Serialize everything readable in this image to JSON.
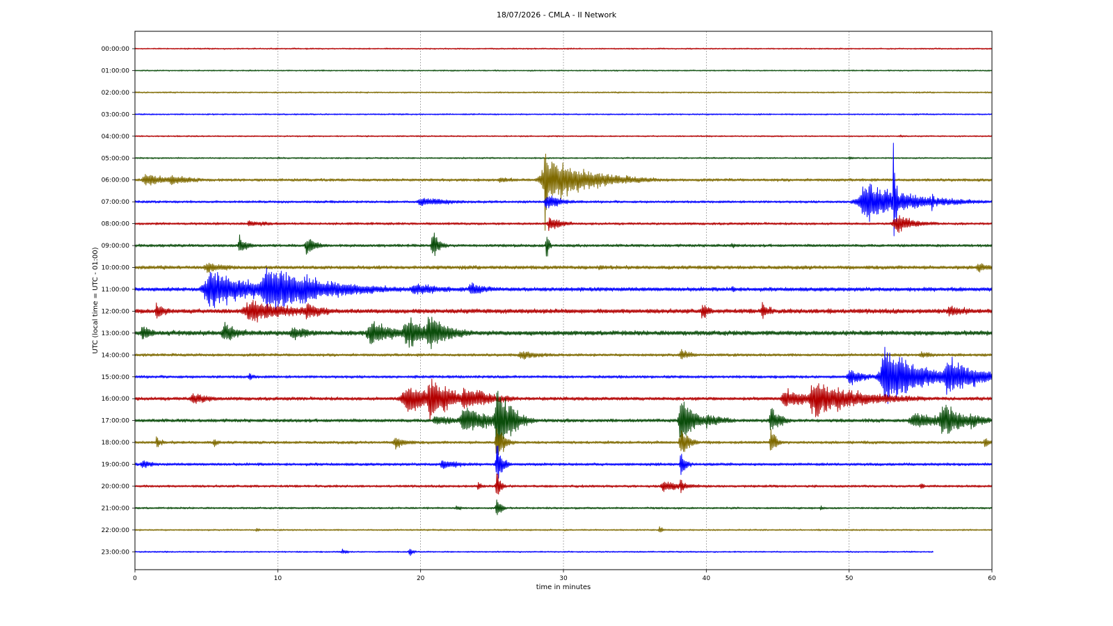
{
  "chart_data": {
    "type": "line",
    "title": "18/07/2026 - CMLA - II Network",
    "xlabel": "time in minutes",
    "ylabel": "UTC (local time = UTC - 01:00)",
    "xlim": [
      0,
      60
    ],
    "xticks": [
      0,
      10,
      20,
      30,
      40,
      50,
      60
    ],
    "grid": "vertical dashed",
    "colors": [
      "#b30000",
      "#0b4d0b",
      "#7f6a00",
      "#0000ff"
    ],
    "rows": [
      {
        "label": "00:00:00",
        "noise": 1.2,
        "events": []
      },
      {
        "label": "01:00:00",
        "noise": 1.2,
        "events": []
      },
      {
        "label": "02:00:00",
        "noise": 1.3,
        "events": []
      },
      {
        "label": "03:00:00",
        "noise": 1.3,
        "events": [
          {
            "t": 37.5,
            "amp": 2,
            "dur": 0.3
          }
        ]
      },
      {
        "label": "04:00:00",
        "noise": 1.3,
        "events": [
          {
            "t": 53.5,
            "amp": 3,
            "dur": 0.6
          }
        ]
      },
      {
        "label": "05:00:00",
        "noise": 1.4,
        "events": [
          {
            "t": 10,
            "amp": 3,
            "dur": 0.3
          },
          {
            "t": 50,
            "amp": 4,
            "dur": 0.6
          }
        ]
      },
      {
        "label": "06:00:00",
        "noise": 2.5,
        "events": [
          {
            "t": 0.7,
            "amp": 14,
            "dur": 1.5
          },
          {
            "t": 2.5,
            "amp": 10,
            "dur": 2.0
          },
          {
            "t": 25.5,
            "amp": 6,
            "dur": 1.5
          },
          {
            "t": 28.7,
            "amp": 120,
            "dur": 0.25
          },
          {
            "t": 28.8,
            "amp": 45,
            "dur": 3.0
          },
          {
            "t": 32.5,
            "amp": 10,
            "dur": 1.0
          },
          {
            "t": 35,
            "amp": 6,
            "dur": 1.0
          }
        ]
      },
      {
        "label": "07:00:00",
        "noise": 2.2,
        "events": [
          {
            "t": 20,
            "amp": 9,
            "dur": 2.5
          },
          {
            "t": 28.8,
            "amp": 14,
            "dur": 1.2
          },
          {
            "t": 51,
            "amp": 35,
            "dur": 3.5
          },
          {
            "t": 53.1,
            "amp": 110,
            "dur": 0.2
          },
          {
            "t": 55.8,
            "amp": 20,
            "dur": 0.2
          }
        ]
      },
      {
        "label": "08:00:00",
        "noise": 2.2,
        "events": [
          {
            "t": 8,
            "amp": 6,
            "dur": 2.0
          },
          {
            "t": 29,
            "amp": 14,
            "dur": 1.0
          },
          {
            "t": 53.2,
            "amp": 18,
            "dur": 1.5
          }
        ]
      },
      {
        "label": "09:00:00",
        "noise": 2.5,
        "events": [
          {
            "t": 7.3,
            "amp": 18,
            "dur": 0.6
          },
          {
            "t": 12,
            "amp": 18,
            "dur": 0.8
          },
          {
            "t": 20.8,
            "amp": 28,
            "dur": 0.5
          },
          {
            "t": 28.8,
            "amp": 40,
            "dur": 0.15
          },
          {
            "t": 41.8,
            "amp": 6,
            "dur": 0.5
          }
        ]
      },
      {
        "label": "10:00:00",
        "noise": 3.2,
        "events": [
          {
            "t": 5,
            "amp": 10,
            "dur": 2.0
          },
          {
            "t": 32.5,
            "amp": 6,
            "dur": 1.0
          },
          {
            "t": 59,
            "amp": 10,
            "dur": 1.2
          }
        ]
      },
      {
        "label": "11:00:00",
        "noise": 3.5,
        "events": [
          {
            "t": 5.2,
            "amp": 40,
            "dur": 3.0
          },
          {
            "t": 9.2,
            "amp": 48,
            "dur": 4.0
          },
          {
            "t": 12,
            "amp": 14,
            "dur": 2.0
          },
          {
            "t": 19.5,
            "amp": 12,
            "dur": 2.5
          },
          {
            "t": 23.5,
            "amp": 12,
            "dur": 1.5
          },
          {
            "t": 41.8,
            "amp": 8,
            "dur": 0.5
          }
        ]
      },
      {
        "label": "12:00:00",
        "noise": 4,
        "events": [
          {
            "t": 1.5,
            "amp": 16,
            "dur": 0.8
          },
          {
            "t": 8,
            "amp": 20,
            "dur": 4.0
          },
          {
            "t": 12,
            "amp": 16,
            "dur": 1.5
          },
          {
            "t": 39.7,
            "amp": 18,
            "dur": 0.5
          },
          {
            "t": 43.9,
            "amp": 18,
            "dur": 0.6
          },
          {
            "t": 48.5,
            "amp": 8,
            "dur": 0.5
          },
          {
            "t": 57,
            "amp": 10,
            "dur": 2.0
          }
        ]
      },
      {
        "label": "13:00:00",
        "noise": 4.2,
        "events": [
          {
            "t": 0.5,
            "amp": 14,
            "dur": 1.0
          },
          {
            "t": 6.2,
            "amp": 20,
            "dur": 1.2
          },
          {
            "t": 11,
            "amp": 14,
            "dur": 1.5
          },
          {
            "t": 16.5,
            "amp": 22,
            "dur": 2.5
          },
          {
            "t": 19,
            "amp": 28,
            "dur": 2.5
          },
          {
            "t": 20.5,
            "amp": 36,
            "dur": 1.5
          }
        ]
      },
      {
        "label": "14:00:00",
        "noise": 2.5,
        "events": [
          {
            "t": 27,
            "amp": 8,
            "dur": 2.0
          },
          {
            "t": 38.2,
            "amp": 10,
            "dur": 1.0
          },
          {
            "t": 55,
            "amp": 6,
            "dur": 1.5
          }
        ]
      },
      {
        "label": "15:00:00",
        "noise": 2.5,
        "events": [
          {
            "t": 8,
            "amp": 8,
            "dur": 0.5
          },
          {
            "t": 50,
            "amp": 16,
            "dur": 1.2
          },
          {
            "t": 52.5,
            "amp": 60,
            "dur": 2.5
          },
          {
            "t": 53.3,
            "amp": 30,
            "dur": 2.0
          },
          {
            "t": 56.8,
            "amp": 36,
            "dur": 2.5
          },
          {
            "t": 58.5,
            "amp": 12,
            "dur": 1.0
          }
        ]
      },
      {
        "label": "16:00:00",
        "noise": 3,
        "events": [
          {
            "t": 4,
            "amp": 12,
            "dur": 1.5
          },
          {
            "t": 19,
            "amp": 28,
            "dur": 3.0
          },
          {
            "t": 20.6,
            "amp": 46,
            "dur": 1.5
          },
          {
            "t": 23,
            "amp": 25,
            "dur": 2.0
          },
          {
            "t": 45.5,
            "amp": 18,
            "dur": 2.0
          },
          {
            "t": 47.5,
            "amp": 34,
            "dur": 3.5
          },
          {
            "t": 49.5,
            "amp": 14,
            "dur": 2.0
          },
          {
            "t": 52.5,
            "amp": 14,
            "dur": 0.5
          }
        ]
      },
      {
        "label": "17:00:00",
        "noise": 3,
        "events": [
          {
            "t": 21,
            "amp": 10,
            "dur": 2.0
          },
          {
            "t": 23,
            "amp": 28,
            "dur": 2.0
          },
          {
            "t": 25.3,
            "amp": 90,
            "dur": 0.8
          },
          {
            "t": 26.2,
            "amp": 40,
            "dur": 0.8
          },
          {
            "t": 38.2,
            "amp": 54,
            "dur": 0.9
          },
          {
            "t": 40,
            "amp": 14,
            "dur": 1.5
          },
          {
            "t": 44.5,
            "amp": 28,
            "dur": 0.7
          },
          {
            "t": 54.5,
            "amp": 16,
            "dur": 2.5
          },
          {
            "t": 56.5,
            "amp": 36,
            "dur": 1.5
          },
          {
            "t": 58.5,
            "amp": 18,
            "dur": 1.0
          }
        ]
      },
      {
        "label": "18:00:00",
        "noise": 2.5,
        "events": [
          {
            "t": 1.5,
            "amp": 10,
            "dur": 0.5
          },
          {
            "t": 5.5,
            "amp": 8,
            "dur": 0.5
          },
          {
            "t": 18.2,
            "amp": 12,
            "dur": 1.0
          },
          {
            "t": 25.3,
            "amp": 40,
            "dur": 0.5
          },
          {
            "t": 38.2,
            "amp": 30,
            "dur": 0.6
          },
          {
            "t": 44.5,
            "amp": 28,
            "dur": 0.4
          },
          {
            "t": 59.5,
            "amp": 10,
            "dur": 0.5
          }
        ]
      },
      {
        "label": "19:00:00",
        "noise": 2.5,
        "events": [
          {
            "t": 0.5,
            "amp": 8,
            "dur": 1.0
          },
          {
            "t": 21.5,
            "amp": 10,
            "dur": 1.5
          },
          {
            "t": 25.3,
            "amp": 40,
            "dur": 0.4
          },
          {
            "t": 38.2,
            "amp": 26,
            "dur": 0.4
          }
        ]
      },
      {
        "label": "20:00:00",
        "noise": 2.2,
        "events": [
          {
            "t": 24,
            "amp": 10,
            "dur": 0.3
          },
          {
            "t": 25.3,
            "amp": 30,
            "dur": 0.3
          },
          {
            "t": 37,
            "amp": 10,
            "dur": 2.0
          },
          {
            "t": 38.2,
            "amp": 14,
            "dur": 0.4
          },
          {
            "t": 55,
            "amp": 8,
            "dur": 0.3
          }
        ]
      },
      {
        "label": "21:00:00",
        "noise": 1.8,
        "events": [
          {
            "t": 22.5,
            "amp": 6,
            "dur": 0.4
          },
          {
            "t": 25.3,
            "amp": 28,
            "dur": 0.3
          },
          {
            "t": 48,
            "amp": 4,
            "dur": 0.3
          }
        ]
      },
      {
        "label": "22:00:00",
        "noise": 1.4,
        "events": [
          {
            "t": 8.5,
            "amp": 4,
            "dur": 0.4
          },
          {
            "t": 36.7,
            "amp": 8,
            "dur": 0.3
          }
        ]
      },
      {
        "label": "23:00:00",
        "noise": 1.3,
        "end": 55.9,
        "events": [
          {
            "t": 14.5,
            "amp": 6,
            "dur": 0.4
          },
          {
            "t": 19.2,
            "amp": 9,
            "dur": 0.3
          }
        ]
      }
    ]
  }
}
